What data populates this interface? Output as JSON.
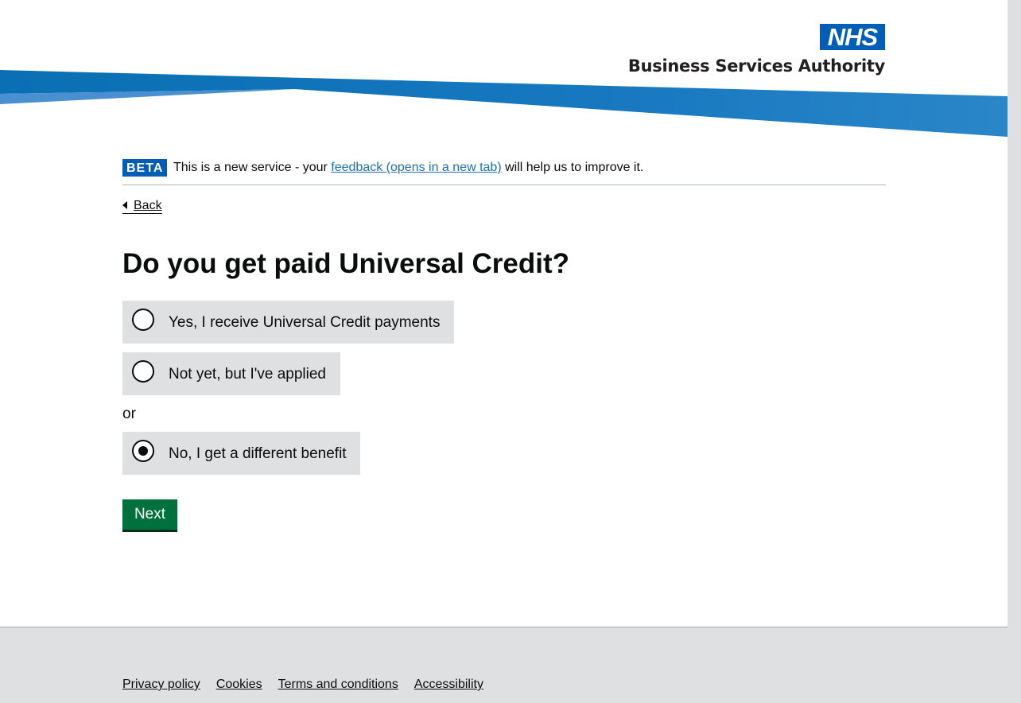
{
  "header": {
    "logo_text": "NHS",
    "org_name": "Business Services Authority",
    "brand_color": "#005eb8"
  },
  "beta_banner": {
    "tag": "BETA",
    "text_before": "This is a new service - your ",
    "link_text": "feedback (opens in a new tab)",
    "text_after": " will help us to improve it."
  },
  "back_link": {
    "label": "Back"
  },
  "question": {
    "title": "Do you get paid Universal Credit?"
  },
  "options": [
    {
      "label": "Yes, I receive Universal Credit payments",
      "selected": false
    },
    {
      "label": "Not yet, but I've applied",
      "selected": false
    },
    {
      "label": "No, I get a different benefit",
      "selected": true
    }
  ],
  "divider_text": "or",
  "next_button": {
    "label": "Next",
    "color": "#00703c"
  },
  "footer": {
    "links": [
      "Privacy policy",
      "Cookies",
      "Terms and conditions",
      "Accessibility"
    ]
  }
}
